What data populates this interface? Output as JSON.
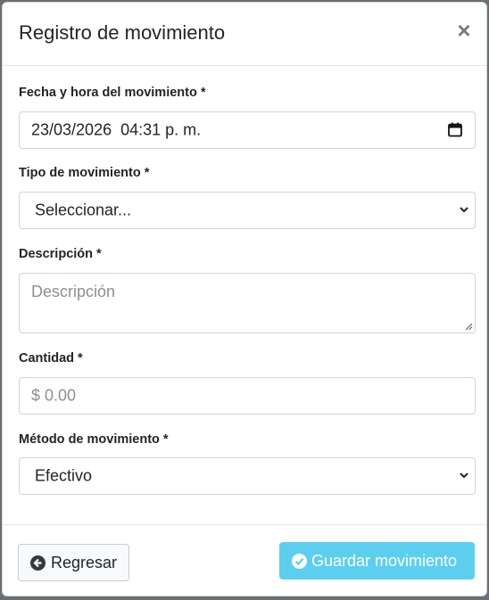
{
  "modal": {
    "title": "Registro de movimiento",
    "close_symbol": "×"
  },
  "form": {
    "datetime": {
      "label": "Fecha y hora del movimiento *",
      "value": "23/03/2026  04:31 p. m.",
      "icon": "calendar-icon"
    },
    "type": {
      "label": "Tipo de movimiento *",
      "selected": "Seleccionar..."
    },
    "description": {
      "label": "Descripción *",
      "placeholder": "Descripción"
    },
    "amount": {
      "label": "Cantidad *",
      "placeholder": "$ 0.00"
    },
    "method": {
      "label": "Método de movimiento *",
      "selected": "Efectivo"
    }
  },
  "footer": {
    "back_label": "Regresar",
    "back_icon": "arrow-left-circle-icon",
    "save_label": "Guardar movimiento",
    "save_icon": "check-circle-icon",
    "save_color": "#5ccff0"
  }
}
